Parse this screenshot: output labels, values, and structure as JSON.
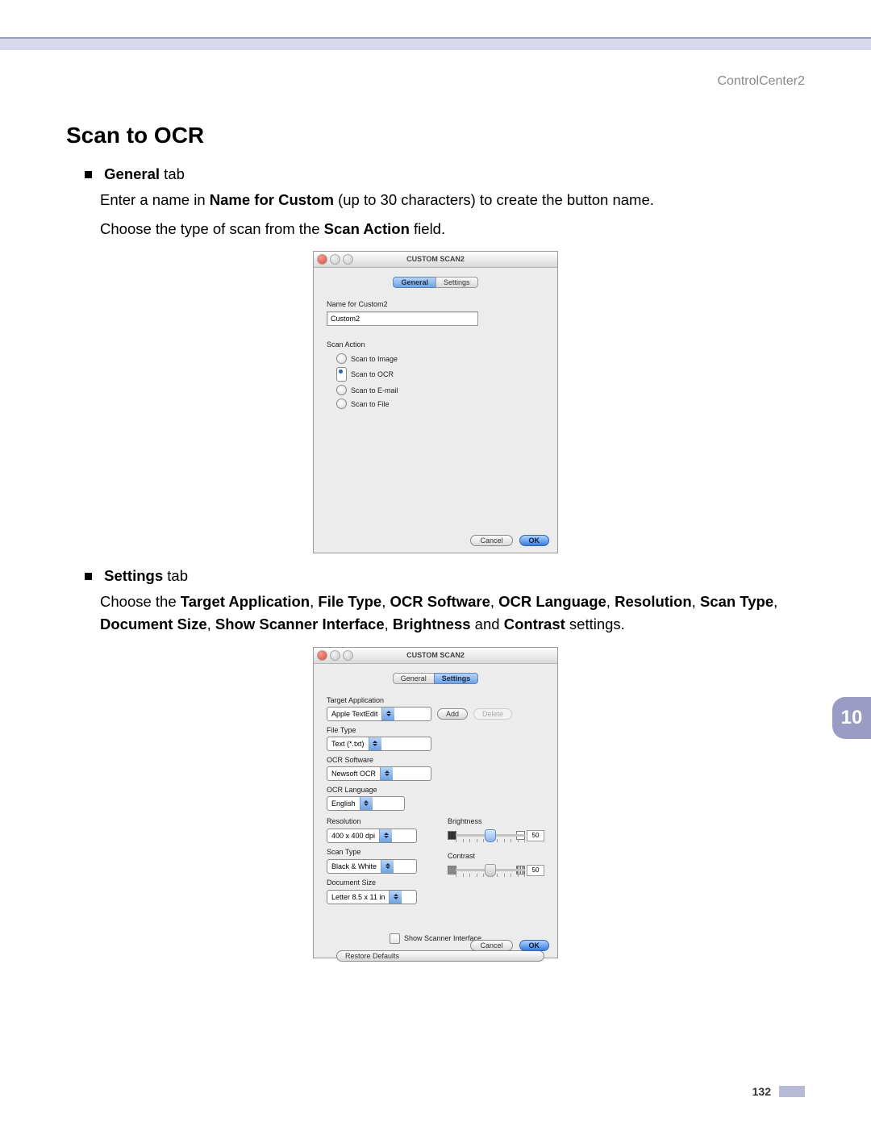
{
  "header": {
    "app_label": "ControlCenter2"
  },
  "section_title": "Scan to OCR",
  "general": {
    "bullet_label_bold": "General",
    "bullet_label_suffix": " tab",
    "para1_prefix": "Enter a name in ",
    "para1_bold": "Name for Custom",
    "para1_suffix": " (up to 30 characters) to create the button name.",
    "para2_prefix": "Choose the type of scan from the ",
    "para2_bold": "Scan Action",
    "para2_suffix": " field."
  },
  "shot1": {
    "title": "CUSTOM SCAN2",
    "tab_general": "General",
    "tab_settings": "Settings",
    "name_label": "Name for Custom2",
    "name_value": "Custom2",
    "scan_action_label": "Scan Action",
    "opt_image": "Scan to Image",
    "opt_ocr": "Scan to OCR",
    "opt_email": "Scan to E-mail",
    "opt_file": "Scan to File",
    "cancel": "Cancel",
    "ok": "OK"
  },
  "settings": {
    "bullet_label_bold": "Settings",
    "bullet_label_suffix": " tab",
    "para_parts": {
      "p0": "Choose the ",
      "b0": "Target Application",
      "b1": "File Type",
      "b2": "OCR Software",
      "b3": "OCR Language",
      "b4": "Resolution",
      "b5": "Scan Type",
      "b6": "Document Size",
      "b7": "Show Scanner Interface",
      "b8": "Brightness",
      "b9": "Contrast",
      "tail": " settings."
    }
  },
  "shot2": {
    "title": "CUSTOM SCAN2",
    "tab_general": "General",
    "tab_settings": "Settings",
    "target_app_label": "Target Application",
    "target_app_value": "Apple TextEdit",
    "add_btn": "Add",
    "delete_btn": "Delete",
    "file_type_label": "File Type",
    "file_type_value": "Text (*.txt)",
    "ocr_sw_label": "OCR Software",
    "ocr_sw_value": "Newsoft OCR",
    "ocr_lang_label": "OCR Language",
    "ocr_lang_value": "English",
    "resolution_label": "Resolution",
    "resolution_value": "400 x 400 dpi",
    "scan_type_label": "Scan Type",
    "scan_type_value": "Black & White",
    "doc_size_label": "Document Size",
    "doc_size_value": "Letter  8.5 x 11 in",
    "brightness_label": "Brightness",
    "brightness_value": "50",
    "contrast_label": "Contrast",
    "contrast_value": "50",
    "show_scanner": "Show Scanner Interface",
    "restore": "Restore Defaults",
    "cancel": "Cancel",
    "ok": "OK"
  },
  "side_chapter": "10",
  "page_number": "132"
}
